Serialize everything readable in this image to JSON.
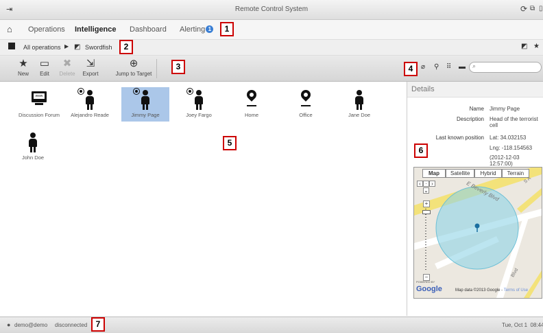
{
  "app": {
    "title": "Remote Control System"
  },
  "menu": {
    "items": [
      {
        "label": "Operations"
      },
      {
        "label": "Intelligence"
      },
      {
        "label": "Dashboard"
      },
      {
        "label": "Alerting"
      }
    ],
    "alert_badge": "1"
  },
  "breadcrumb": {
    "root": "All operations",
    "current": "Swordfish"
  },
  "toolbar": {
    "new": "New",
    "edit": "Edit",
    "delete": "Delete",
    "export": "Export",
    "jump": "Jump to Target"
  },
  "entities": [
    {
      "label": "Discussion Forum",
      "icon": "monitor-icon"
    },
    {
      "label": "Alejandro Reade",
      "icon": "target-person-icon"
    },
    {
      "label": "Jimmy Page",
      "icon": "target-person-icon",
      "selected": true
    },
    {
      "label": "Joey Fargo",
      "icon": "target-person-icon"
    },
    {
      "label": "Home",
      "icon": "map-pin-icon"
    },
    {
      "label": "Office",
      "icon": "map-pin-icon"
    },
    {
      "label": "Jane Doe",
      "icon": "person-icon"
    },
    {
      "label": "John Doe",
      "icon": "person-icon"
    }
  ],
  "details": {
    "header": "Details",
    "name_label": "Name",
    "name": "Jimmy Page",
    "desc_label": "Description",
    "desc": "Head of the terrorist cell",
    "pos_label": "Last known position",
    "lat": "Lat: 34.032153",
    "lng": "Lng: -118.154563",
    "time": "(2012-12-03 12:57:00)"
  },
  "map": {
    "tabs": [
      "Map",
      "Satellite",
      "Hybrid",
      "Terrain"
    ],
    "streets": [
      "E Beverly Blvd",
      "S A",
      "Blvd"
    ],
    "attribution": "Map data ©2013",
    "google": "Google",
    "terms_prefix": "Google - ",
    "terms": "Terms of Use",
    "powered": "POWERED BY"
  },
  "status": {
    "user": "demo@demo",
    "conn": "disconnected",
    "time": "Tue, Oct 1  08:44"
  },
  "callouts": [
    "1",
    "2",
    "3",
    "4",
    "5",
    "6",
    "7"
  ],
  "colors": {
    "selection": "#abc7e9",
    "badge": "#3a7fd5",
    "callout": "#cc0000",
    "map_circle": "#8fd3e6"
  }
}
